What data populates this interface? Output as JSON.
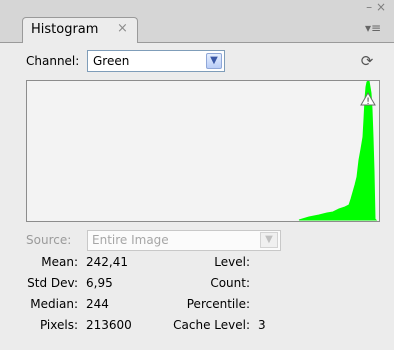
{
  "window": {
    "controls": "– ×"
  },
  "tab": {
    "label": "Histogram",
    "close": "×"
  },
  "panel_menu": {
    "icon": "panel-menu-icon",
    "glyph": "▾≡"
  },
  "channel": {
    "label": "Channel:",
    "selected": "Green",
    "arrow": "▼"
  },
  "refresh": {
    "icon": "refresh-icon",
    "glyph": "⟳"
  },
  "histogram": {
    "color": "#00ff00",
    "warning_icon": "warning-icon",
    "warning_glyph": "!"
  },
  "source": {
    "label": "Source:",
    "selected": "Entire Image",
    "arrow": "▼"
  },
  "stats_left": [
    {
      "label": "Mean:",
      "value": "242,41"
    },
    {
      "label": "Std Dev:",
      "value": "6,95"
    },
    {
      "label": "Median:",
      "value": "244"
    },
    {
      "label": "Pixels:",
      "value": "213600"
    }
  ],
  "stats_right": [
    {
      "label": "Level:",
      "value": ""
    },
    {
      "label": "Count:",
      "value": ""
    },
    {
      "label": "Percentile:",
      "value": ""
    },
    {
      "label": "Cache Level:",
      "value": "3"
    }
  ]
}
